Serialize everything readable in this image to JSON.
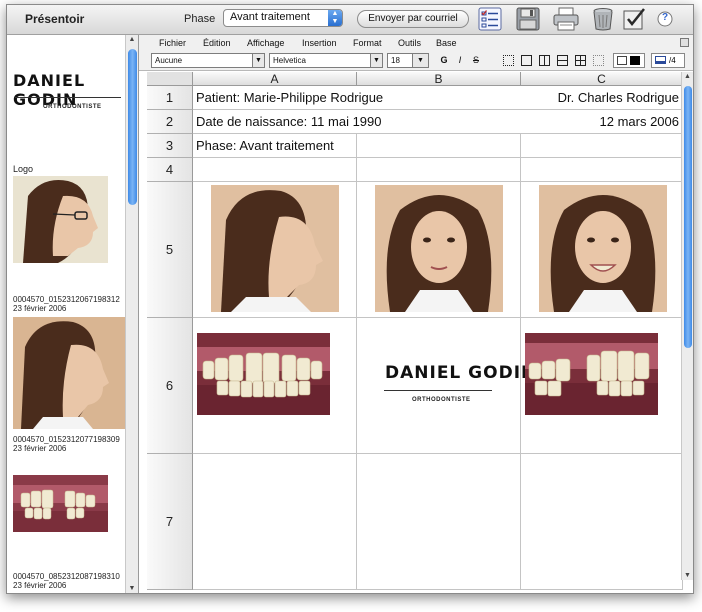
{
  "toolbar": {
    "app_title": "Présentoir",
    "phase_label": "Phase",
    "phase_value": "Avant traitement",
    "email_button": "Envoyer par courriel",
    "icons": [
      "checklist-icon",
      "save-icon",
      "print-icon",
      "trash-icon",
      "checkbox-icon",
      "help-icon"
    ],
    "help_glyph": "?"
  },
  "sidebar": {
    "logo_name": "DANIEL GODIN",
    "logo_subtitle": "ORTHODONTISTE",
    "logo_caption": "Logo",
    "items": [
      {
        "caption_id": "0004570_0152312067198312",
        "caption_date": "23 février 2006"
      },
      {
        "caption_id": "0004570_0152312077198309",
        "caption_date": "23 février 2006"
      },
      {
        "caption_id": "0004570_0852312087198310",
        "caption_date": "23 février 2006"
      }
    ]
  },
  "menubar": [
    "Fichier",
    "Édition",
    "Affichage",
    "Insertion",
    "Format",
    "Outils",
    "Base"
  ],
  "format_bar": {
    "style_value": "Aucune",
    "font_value": "Helvetica",
    "size_value": "18",
    "bold": "G",
    "italic": "I",
    "strike": "S",
    "page_indicator": "/4"
  },
  "grid": {
    "columns": [
      "A",
      "B",
      "C"
    ],
    "rows": [
      "1",
      "2",
      "3",
      "4",
      "5",
      "6",
      "7"
    ],
    "cells": {
      "a1": "Patient: Marie-Philippe Rodrigue",
      "c1": "Dr. Charles Rodrigue",
      "a2": "Date de naissance: 11 mai 1990",
      "c2": "12 mars 2006",
      "a3": "Phase: Avant traitement"
    },
    "b6_logo_name": "DANIEL GODIN",
    "b6_logo_subtitle": "ORTHODONTISTE"
  },
  "colors": {
    "accent": "#2a6fd0",
    "skin": "#e9c6a8",
    "hair": "#4a2c1c",
    "gums": "#b25a6a",
    "teeth": "#f1ead2",
    "background_photo": "#d9b592"
  }
}
